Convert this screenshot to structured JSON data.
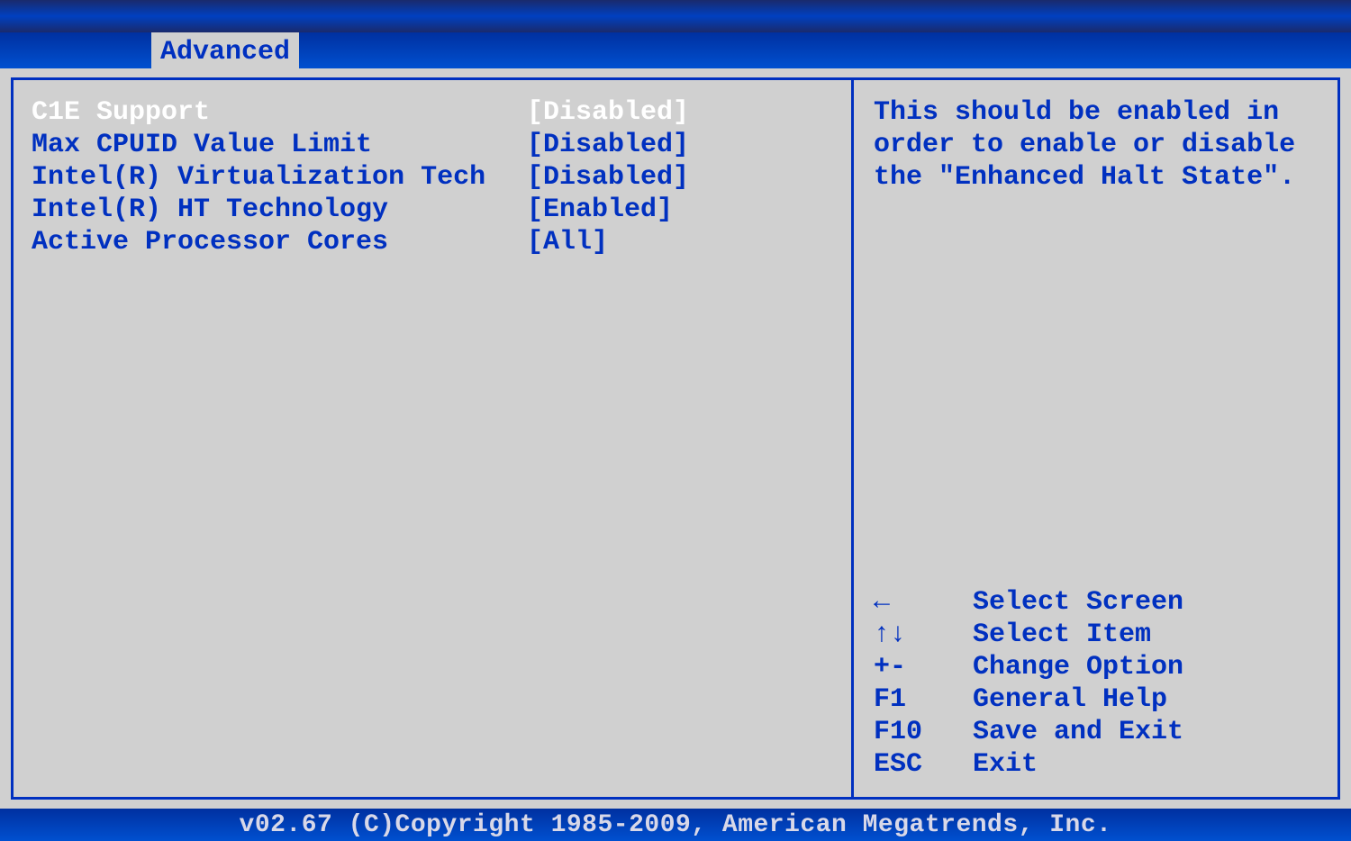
{
  "tab": {
    "label": "Advanced"
  },
  "settings": [
    {
      "label": "C1E Support",
      "value": "[Disabled]",
      "selected": true
    },
    {
      "label": "Max CPUID Value Limit",
      "value": "[Disabled]",
      "selected": false
    },
    {
      "label": "Intel(R) Virtualization Tech",
      "value": "[Disabled]",
      "selected": false
    },
    {
      "label": "Intel(R) HT Technology",
      "value": "[Enabled]",
      "selected": false
    },
    {
      "label": "Active Processor Cores",
      "value": "[All]",
      "selected": false
    }
  ],
  "help": {
    "text": "This should be enabled in order to enable or disable the \"Enhanced Halt State\"."
  },
  "keys": [
    {
      "key": "←",
      "desc": "Select Screen"
    },
    {
      "key": "↑↓",
      "desc": "Select Item"
    },
    {
      "key": "+-",
      "desc": "Change Option"
    },
    {
      "key": "F1",
      "desc": "General Help"
    },
    {
      "key": "F10",
      "desc": "Save and Exit"
    },
    {
      "key": "ESC",
      "desc": "Exit"
    }
  ],
  "footer": {
    "text": "v02.67 (C)Copyright 1985-2009, American Megatrends, Inc."
  }
}
